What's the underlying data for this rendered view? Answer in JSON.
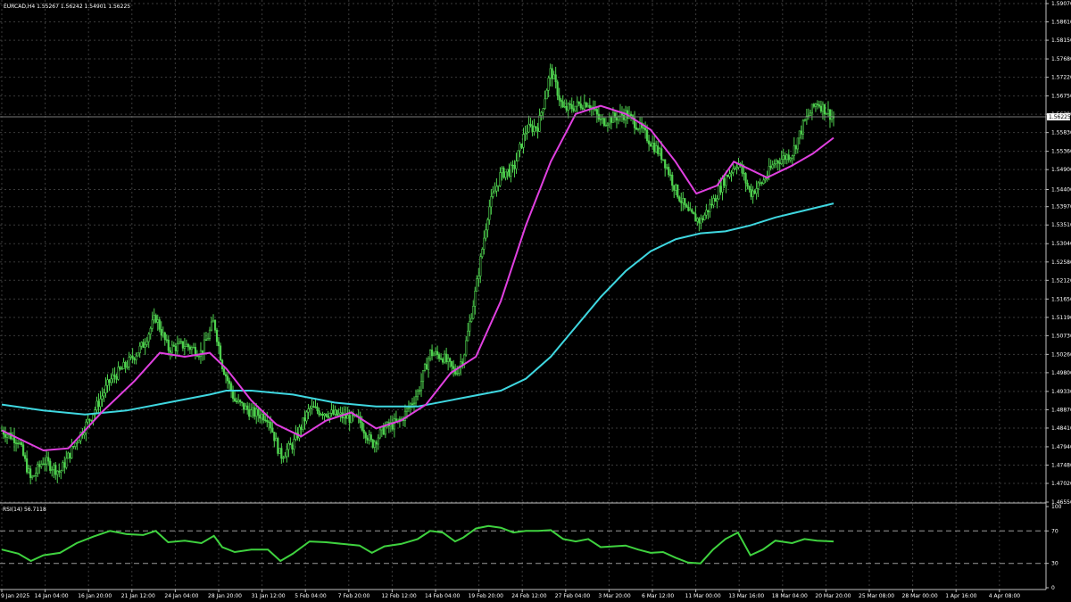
{
  "symbol_info": "EURCAD,H4  1.55267 1.56242 1.54901 1.56225",
  "rsi_label": "RSI(14) 56.7118",
  "current_price_label": "1.56225",
  "colors": {
    "background": "#000000",
    "grid": "#3a3a3a",
    "axis": "#c0c0c0",
    "candles": "#4fd24f",
    "ma_fast": "#e040e0",
    "ma_slow": "#3fd7e0",
    "rsi_line": "#3fd23f"
  },
  "chart_data": [
    {
      "type": "candlestick",
      "series_names": [],
      "price_axis_ticks": [
        "1.59070",
        "1.58610",
        "1.58150",
        "1.57680",
        "1.57220",
        "1.56750",
        "1.56290",
        "1.55830",
        "1.55360",
        "1.54900",
        "1.54400",
        "1.53970",
        "1.53510",
        "1.53040",
        "1.52580",
        "1.52120",
        "1.51650",
        "1.51190",
        "1.50730",
        "1.50260",
        "1.49800",
        "1.49330",
        "1.48870",
        "1.48410",
        "1.47940",
        "1.47480",
        "1.47020",
        "1.46550"
      ],
      "ylim": [
        1.4655,
        1.5907
      ],
      "time_axis_ticks": [
        "9 Jan 2025",
        "14 Jan 04:00",
        "16 Jan 20:00",
        "21 Jan 12:00",
        "24 Jan 04:00",
        "28 Jan 20:00",
        "31 Jan 12:00",
        "5 Feb 04:00",
        "7 Feb 20:00",
        "12 Feb 12:00",
        "14 Feb 04:00",
        "19 Feb 20:00",
        "24 Feb 12:00",
        "27 Feb 04:00",
        "3 Mar 20:00",
        "6 Mar 12:00",
        "11 Mar 00:00",
        "13 Mar 16:00",
        "18 Mar 04:00",
        "20 Mar 20:00",
        "25 Mar 08:00",
        "28 Mar 00:00",
        "1 Apr 16:00",
        "4 Apr 08:00"
      ],
      "price_path": [
        [
          0,
          1.4835
        ],
        [
          0.02,
          1.481
        ],
        [
          0.035,
          1.471
        ],
        [
          0.05,
          1.476
        ],
        [
          0.07,
          1.473
        ],
        [
          0.09,
          1.481
        ],
        [
          0.11,
          1.488
        ],
        [
          0.13,
          1.496
        ],
        [
          0.15,
          1.5
        ],
        [
          0.17,
          1.505
        ],
        [
          0.185,
          1.512
        ],
        [
          0.2,
          1.504
        ],
        [
          0.22,
          1.505
        ],
        [
          0.24,
          1.503
        ],
        [
          0.255,
          1.511
        ],
        [
          0.265,
          1.5
        ],
        [
          0.28,
          1.491
        ],
        [
          0.3,
          1.488
        ],
        [
          0.32,
          1.487
        ],
        [
          0.335,
          1.477
        ],
        [
          0.35,
          1.48
        ],
        [
          0.37,
          1.489
        ],
        [
          0.39,
          1.488
        ],
        [
          0.41,
          1.487
        ],
        [
          0.43,
          1.486
        ],
        [
          0.445,
          1.48
        ],
        [
          0.46,
          1.484
        ],
        [
          0.48,
          1.486
        ],
        [
          0.5,
          1.493
        ],
        [
          0.515,
          1.503
        ],
        [
          0.53,
          1.502
        ],
        [
          0.545,
          1.498
        ],
        [
          0.555,
          1.502
        ],
        [
          0.57,
          1.519
        ],
        [
          0.585,
          1.539
        ],
        [
          0.6,
          1.548
        ],
        [
          0.615,
          1.549
        ],
        [
          0.63,
          1.559
        ],
        [
          0.645,
          1.56
        ],
        [
          0.66,
          1.574
        ],
        [
          0.675,
          1.564
        ],
        [
          0.69,
          1.565
        ],
        [
          0.705,
          1.566
        ],
        [
          0.72,
          1.561
        ],
        [
          0.735,
          1.562
        ],
        [
          0.75,
          1.563
        ],
        [
          0.765,
          1.56
        ],
        [
          0.78,
          1.556
        ],
        [
          0.795,
          1.552
        ],
        [
          0.81,
          1.544
        ],
        [
          0.825,
          1.538
        ],
        [
          0.84,
          1.536
        ],
        [
          0.855,
          1.541
        ],
        [
          0.87,
          1.547
        ],
        [
          0.885,
          1.551
        ],
        [
          0.9,
          1.543
        ],
        [
          0.915,
          1.546
        ],
        [
          0.93,
          1.551
        ],
        [
          0.95,
          1.553
        ],
        [
          0.965,
          1.561
        ],
        [
          0.98,
          1.566
        ],
        [
          1,
          1.562
        ]
      ],
      "ma_fast": [
        [
          0,
          1.4835
        ],
        [
          0.05,
          1.4785
        ],
        [
          0.08,
          1.479
        ],
        [
          0.12,
          1.488
        ],
        [
          0.16,
          1.496
        ],
        [
          0.19,
          1.503
        ],
        [
          0.22,
          1.502
        ],
        [
          0.25,
          1.503
        ],
        [
          0.27,
          1.499
        ],
        [
          0.3,
          1.491
        ],
        [
          0.33,
          1.485
        ],
        [
          0.36,
          1.482
        ],
        [
          0.39,
          1.486
        ],
        [
          0.42,
          1.488
        ],
        [
          0.45,
          1.484
        ],
        [
          0.48,
          1.486
        ],
        [
          0.51,
          1.49
        ],
        [
          0.54,
          1.498
        ],
        [
          0.57,
          1.502
        ],
        [
          0.6,
          1.516
        ],
        [
          0.63,
          1.535
        ],
        [
          0.66,
          1.551
        ],
        [
          0.69,
          1.563
        ],
        [
          0.72,
          1.565
        ],
        [
          0.75,
          1.563
        ],
        [
          0.78,
          1.559
        ],
        [
          0.81,
          1.551
        ],
        [
          0.835,
          1.543
        ],
        [
          0.86,
          1.545
        ],
        [
          0.88,
          1.551
        ],
        [
          0.9,
          1.549
        ],
        [
          0.92,
          1.547
        ],
        [
          0.95,
          1.55
        ],
        [
          0.975,
          1.553
        ],
        [
          1,
          1.557
        ]
      ],
      "ma_slow": [
        [
          0,
          1.49
        ],
        [
          0.05,
          1.4885
        ],
        [
          0.1,
          1.4875
        ],
        [
          0.15,
          1.4885
        ],
        [
          0.2,
          1.4905
        ],
        [
          0.25,
          1.4925
        ],
        [
          0.27,
          1.4935
        ],
        [
          0.3,
          1.4935
        ],
        [
          0.35,
          1.4925
        ],
        [
          0.4,
          1.4905
        ],
        [
          0.45,
          1.4895
        ],
        [
          0.5,
          1.4895
        ],
        [
          0.55,
          1.4915
        ],
        [
          0.6,
          1.4935
        ],
        [
          0.63,
          1.4965
        ],
        [
          0.66,
          1.502
        ],
        [
          0.69,
          1.5095
        ],
        [
          0.72,
          1.517
        ],
        [
          0.75,
          1.5235
        ],
        [
          0.78,
          1.5285
        ],
        [
          0.81,
          1.5315
        ],
        [
          0.84,
          1.533
        ],
        [
          0.87,
          1.5335
        ],
        [
          0.9,
          1.535
        ],
        [
          0.93,
          1.537
        ],
        [
          0.96,
          1.5385
        ],
        [
          1,
          1.5405
        ]
      ]
    },
    {
      "type": "line",
      "title": "RSI(14) 56.7118",
      "ylim": [
        0,
        100
      ],
      "levels": [
        70,
        30
      ],
      "axis_ticks": [
        "100",
        "70",
        "30",
        "0"
      ],
      "values": [
        [
          0,
          47
        ],
        [
          0.02,
          42
        ],
        [
          0.035,
          33
        ],
        [
          0.05,
          40
        ],
        [
          0.07,
          43
        ],
        [
          0.09,
          55
        ],
        [
          0.11,
          63
        ],
        [
          0.13,
          70
        ],
        [
          0.15,
          66
        ],
        [
          0.17,
          65
        ],
        [
          0.185,
          70
        ],
        [
          0.2,
          56
        ],
        [
          0.22,
          58
        ],
        [
          0.24,
          55
        ],
        [
          0.255,
          64
        ],
        [
          0.265,
          50
        ],
        [
          0.28,
          44
        ],
        [
          0.3,
          47
        ],
        [
          0.32,
          47
        ],
        [
          0.335,
          33
        ],
        [
          0.35,
          42
        ],
        [
          0.37,
          57
        ],
        [
          0.39,
          56
        ],
        [
          0.41,
          54
        ],
        [
          0.43,
          52
        ],
        [
          0.445,
          43
        ],
        [
          0.46,
          51
        ],
        [
          0.48,
          54
        ],
        [
          0.5,
          60
        ],
        [
          0.515,
          70
        ],
        [
          0.53,
          68
        ],
        [
          0.545,
          57
        ],
        [
          0.555,
          62
        ],
        [
          0.57,
          73
        ],
        [
          0.585,
          76
        ],
        [
          0.6,
          74
        ],
        [
          0.615,
          68
        ],
        [
          0.63,
          70
        ],
        [
          0.645,
          70
        ],
        [
          0.66,
          71
        ],
        [
          0.675,
          60
        ],
        [
          0.69,
          57
        ],
        [
          0.705,
          60
        ],
        [
          0.72,
          50
        ],
        [
          0.735,
          51
        ],
        [
          0.75,
          52
        ],
        [
          0.765,
          47
        ],
        [
          0.78,
          43
        ],
        [
          0.795,
          44
        ],
        [
          0.81,
          37
        ],
        [
          0.825,
          31
        ],
        [
          0.84,
          30
        ],
        [
          0.855,
          47
        ],
        [
          0.87,
          60
        ],
        [
          0.885,
          68
        ],
        [
          0.9,
          40
        ],
        [
          0.915,
          47
        ],
        [
          0.93,
          58
        ],
        [
          0.95,
          55
        ],
        [
          0.965,
          60
        ],
        [
          0.98,
          58
        ],
        [
          1,
          57
        ]
      ]
    }
  ]
}
